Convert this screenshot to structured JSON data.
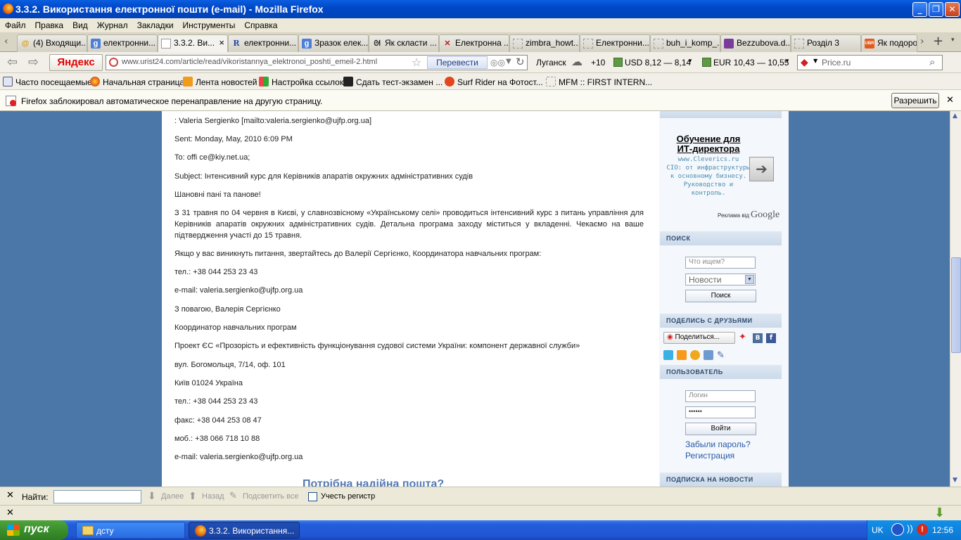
{
  "window": {
    "title": "3.3.2. Використання електронної пошти (e-mail) - Mozilla Firefox"
  },
  "menu": [
    "Файл",
    "Правка",
    "Вид",
    "Журнал",
    "Закладки",
    "Инструменты",
    "Справка"
  ],
  "tabs": [
    {
      "label": "(4) Входящи...",
      "icon": "mail-icon"
    },
    {
      "label": "електронни...",
      "icon": "google-icon"
    },
    {
      "label": "3.3.2. Ви...",
      "icon": "page-icon",
      "active": true
    },
    {
      "label": "електронни...",
      "icon": "r-icon"
    },
    {
      "label": "Зразок елек...",
      "icon": "google-icon"
    },
    {
      "label": "Як скласти ...",
      "icon": "bunny-icon"
    },
    {
      "label": "Електронна ...",
      "icon": "x-icon"
    },
    {
      "label": "zimbra_howt...",
      "icon": "blank-icon"
    },
    {
      "label": "Електронни...",
      "icon": "blank-icon"
    },
    {
      "label": "buh_i_komp_...",
      "icon": "blank-icon"
    },
    {
      "label": "Bezzubova.d...",
      "icon": "book-icon"
    },
    {
      "label": "Розділ 3",
      "icon": "blank-icon"
    },
    {
      "label": "Як подоро",
      "icon": "uvr-icon"
    }
  ],
  "tab_close": "×",
  "uvr_badge": "UBR",
  "nav": {
    "yandex_label": "Яндекс",
    "url": "www.urist24.com/article/read/vikoristannya_elektronoi_poshti_emeil-2.html",
    "translate_label": "Перевести",
    "city": "Луганск",
    "temperature": "+10",
    "usd": "USD 8,12 — 8,14",
    "eur": "EUR 10,43 — 10,55",
    "search_placeholder": "Price.ru"
  },
  "bookmarks": [
    "Часто посещаемые",
    "Начальная страница",
    "Лента новостей",
    "Настройка ссылок",
    "Сдать тест-экзамен ...",
    "Surf Rider на Фотост...",
    "MFM :: FIRST INTERN..."
  ],
  "notification": {
    "text": "Firefox заблокировал автоматическое перенаправление на другую страницу.",
    "allow_label": "Разрешить"
  },
  "article": {
    "lines": [
      ": Valeria Sergienko [mailto:valeria.sergienko@ujfp.org.ua]",
      "Sent: Monday, May, 2010 6:09 PM",
      "To: offi ce@kiy.net.ua;",
      "Subject: Інтенсивний курс для Керівників апаратів окружних адміністративних судів",
      "Шановні пані та панове!",
      "З 31 травня по 04 червня в Києві, у славнозвісному «Українському селі» проводиться інтенсивний курс з питань управління для Керівників апаратів окружних адміністративних судів. Детальна програма заходу міститься у вкладенні. Чекаємо на ваше підтвердження участі до 15 травня.",
      "Якщо у вас виникнуть питання, звертайтесь до Валерії Сергієнко, Координатора навчальних програм:",
      "тел.: +38 044 253 23 43",
      "e-mail: valeria.sergienko@ujfp.org.ua",
      "З повагою, Валерія Сергієнко",
      "Координатор навчальних програм",
      "Проект ЄС «Прозорість и ефективність функціонування судової системи України: компонент державної служби»",
      "вул. Богомольця, 7/14, оф. 101",
      "Київ 01024 Україна",
      "тел.: +38 044 253 23 43",
      "факс: +38 044 253 08 47",
      "моб.: +38 066 718 10 88",
      "e-mail: valeria.sergienko@ujfp.org.ua"
    ],
    "promo": "Потрібна надійна пошта?"
  },
  "sidebar": {
    "ad": {
      "title": "Обучение для ИТ-директора",
      "site": "www.Cleverics.ru",
      "desc": "CIO: от инфраструктуры к основному бизнесу. Руководство и контроль.",
      "label": "Реклама від",
      "google": "Google"
    },
    "search": {
      "header": "ПОИСК",
      "placeholder": "Что ищем?",
      "select_value": "Новости",
      "button": "Поиск"
    },
    "share": {
      "header": "ПОДЕЛИСЬ С ДРУЗЬЯМИ",
      "button": "Поделиться..."
    },
    "user": {
      "header": "ПОЛЬЗОВАТЕЛЬ",
      "login_placeholder": "Логин",
      "password_value": "••••••",
      "login_button": "Войти",
      "forgot": "Забыли пароль?",
      "register": "Регистрация"
    },
    "newsletter": {
      "header": "ПОДПИСКА НА НОВОСТИ"
    }
  },
  "findbar": {
    "label": "Найти:",
    "next": "Далее",
    "prev": "Назад",
    "highlight": "Подсветить все",
    "matchcase": "Учесть регистр"
  },
  "taskbar": {
    "start": "пуск",
    "tasks": [
      "дсту",
      "3.3.2. Використання..."
    ],
    "lang": "UK",
    "clock": "12:56"
  },
  "colors": {
    "page_bg": "#4a77a8",
    "link": "#2a5aa8",
    "promo": "#5479b3",
    "titlebar": "#0048c8"
  }
}
